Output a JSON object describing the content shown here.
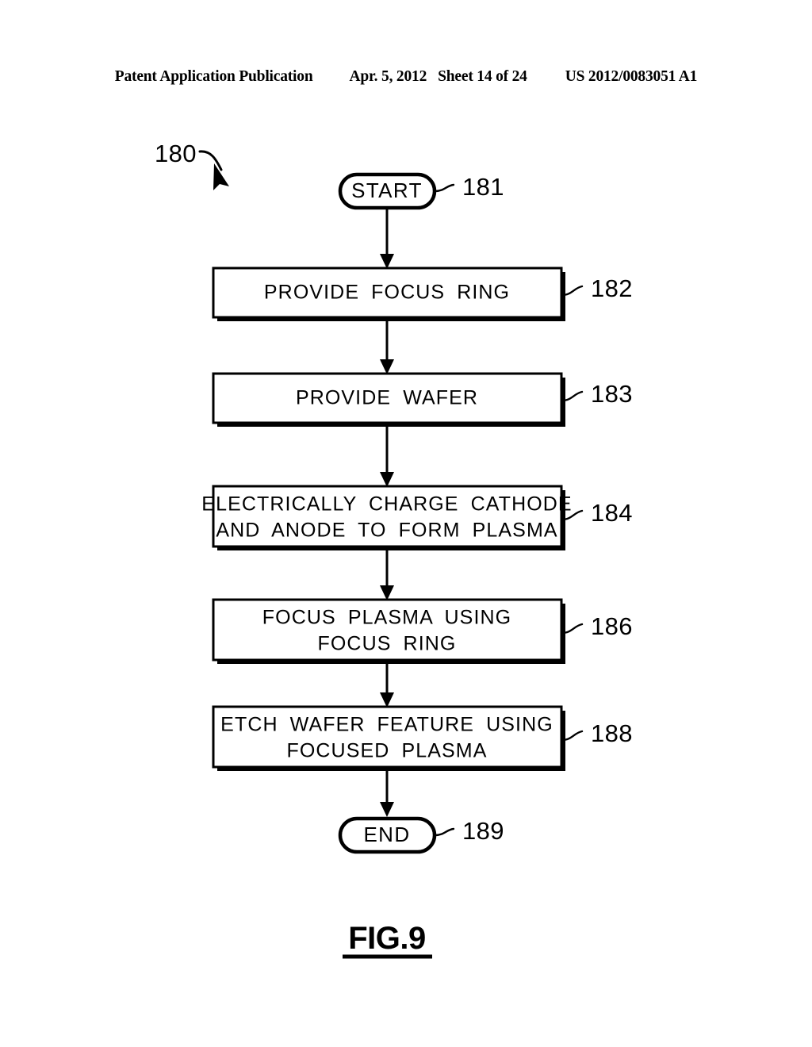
{
  "header": {
    "publication": "Patent Application Publication",
    "date": "Apr. 5, 2012",
    "sheet": "Sheet 14 of 24",
    "doc_number": "US 2012/0083051 A1"
  },
  "figure": {
    "caption": "FIG.9",
    "diagram_ref": "180"
  },
  "flowchart": {
    "start": {
      "label": "START",
      "ref": "181"
    },
    "end": {
      "label": "END",
      "ref": "189"
    },
    "steps": [
      {
        "ref": "182",
        "lines": [
          "PROVIDE  FOCUS  RING"
        ]
      },
      {
        "ref": "183",
        "lines": [
          "PROVIDE  WAFER"
        ]
      },
      {
        "ref": "184",
        "lines": [
          "ELECTRICALLY  CHARGE  CATHODE",
          "AND  ANODE  TO  FORM  PLASMA"
        ]
      },
      {
        "ref": "186",
        "lines": [
          "FOCUS  PLASMA  USING",
          "FOCUS  RING"
        ]
      },
      {
        "ref": "188",
        "lines": [
          "ETCH  WAFER  FEATURE  USING",
          "FOCUSED  PLASMA"
        ]
      }
    ]
  },
  "colors": {
    "ink": "#000000",
    "paper": "#ffffff"
  }
}
